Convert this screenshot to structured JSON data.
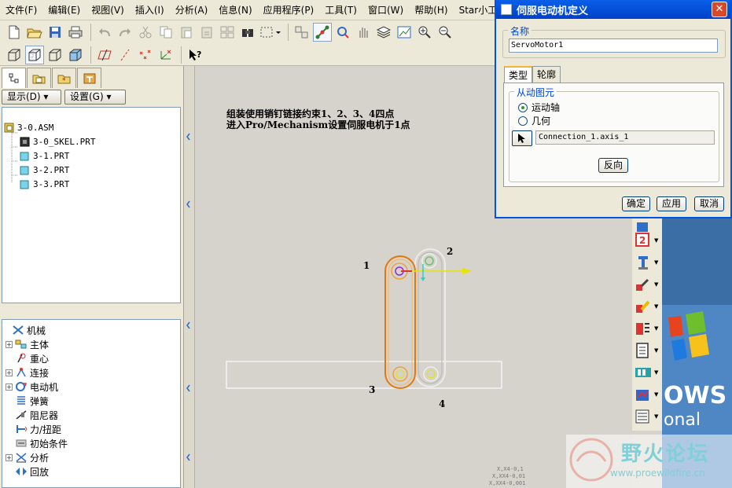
{
  "menu": {
    "items": [
      "文件(F)",
      "编辑(E)",
      "视图(V)",
      "插入(I)",
      "分析(A)",
      "信息(N)",
      "应用程序(P)",
      "工具(T)",
      "窗口(W)",
      "帮助(H)",
      "Star小工具"
    ]
  },
  "left_panel": {
    "display_button": "显示(D) ▾",
    "settings_button": "设置(G) ▾",
    "model_tree": [
      "3-0.ASM",
      "3-0_SKEL.PRT",
      "3-1.PRT",
      "3-2.PRT",
      "3-3.PRT"
    ],
    "mechanism_tree": [
      {
        "label": "机械",
        "expander": ""
      },
      {
        "label": "主体",
        "expander": "+"
      },
      {
        "label": "重心",
        "expander": ""
      },
      {
        "label": "连接",
        "expander": "+"
      },
      {
        "label": "电动机",
        "expander": "+"
      },
      {
        "label": "弹簧",
        "expander": ""
      },
      {
        "label": "阻尼器",
        "expander": ""
      },
      {
        "label": "力/扭距",
        "expander": ""
      },
      {
        "label": "初始条件",
        "expander": ""
      },
      {
        "label": "分析",
        "expander": "+"
      },
      {
        "label": "回放",
        "expander": ""
      }
    ]
  },
  "graphics": {
    "note_line1": "组装使用销钉链接约束1、2、3、4四点",
    "note_line2": "进入Pro/Mechanism设置伺服电机于1点",
    "labels": {
      "p1": "1",
      "p2": "2",
      "p3": "3",
      "p4": "4"
    },
    "coord_lines": [
      "X,X4-0,1",
      "X,XX4-0,01",
      "X,XX4-0,001"
    ]
  },
  "dialog": {
    "title": "伺服电动机定义",
    "name_group": "名称",
    "name_value": "ServoMotor1",
    "tabs": [
      "类型",
      "轮廓"
    ],
    "driven_group": "从动图元",
    "radio_motion_axis": "运动轴",
    "radio_geometry": "几何",
    "reference": "Connection_1.axis_1",
    "flip_button": "反向",
    "ok_button": "确定",
    "apply_button": "应用",
    "cancel_button": "取消"
  },
  "desktop": {
    "xp_text1": "OWS",
    "xp_text2": "onal",
    "watermark_title": "野火论坛",
    "watermark_url": "www.proewildfire.cn"
  },
  "colors": {
    "dialog_title": "#0a5fe8",
    "highlight_link": "#e07a10",
    "gray_link": "#e8e8e8",
    "axis_yellow": "#e6e600"
  }
}
